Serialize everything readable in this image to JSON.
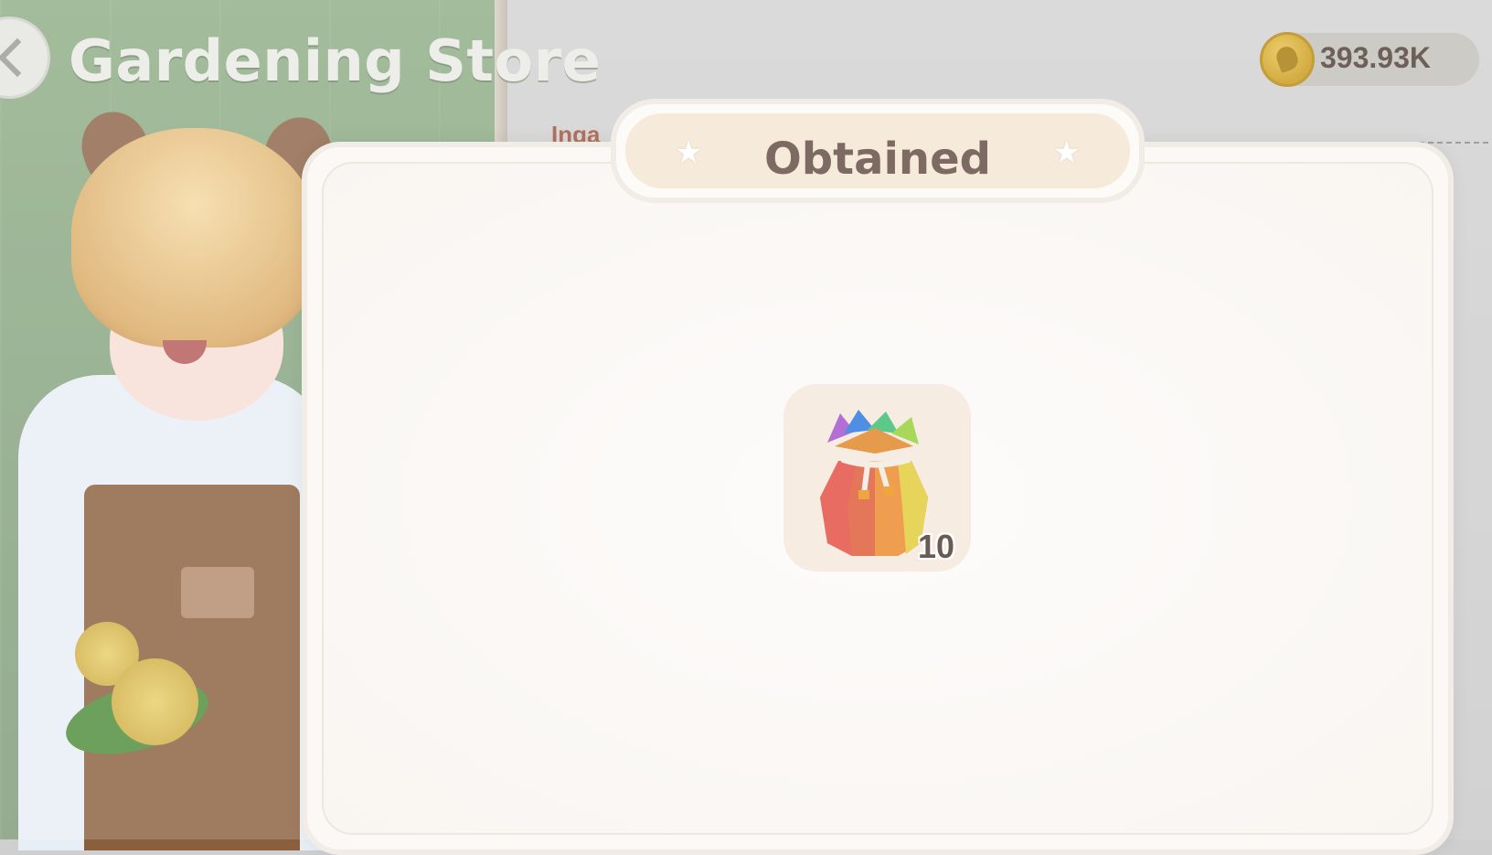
{
  "store": {
    "title": "Gardening Store",
    "back_icon": "chevron-left-icon"
  },
  "currency": {
    "icon": "acorn-coin-icon",
    "value": "393.93K"
  },
  "background": {
    "peek_text": "Inga"
  },
  "dialog": {
    "title": "Obtained",
    "star_icon": "star-icon",
    "reward": {
      "icon": "rainbow-seed-bag-icon",
      "count": "10"
    }
  },
  "colors": {
    "dialog_bg": "#fbf8f5",
    "title_pill": "#f6eadb",
    "title_text": "#7d6b63",
    "coin": "#d4a72a",
    "garden_green": "#8fae86"
  }
}
